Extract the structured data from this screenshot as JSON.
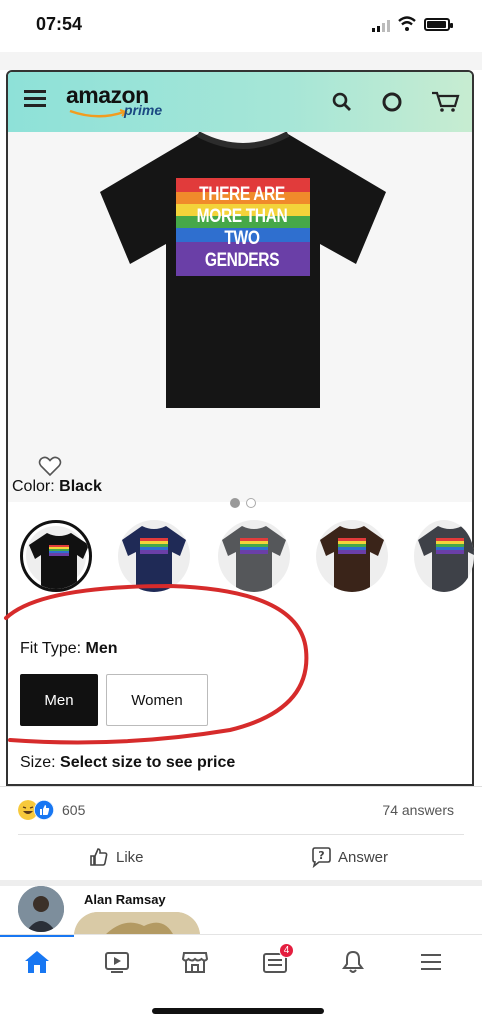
{
  "status_bar": {
    "time": "07:54"
  },
  "amazon": {
    "logo": "amazon",
    "prime": "prime",
    "shirt_text": [
      "THERE ARE",
      "MORE THAN",
      "TWO GENDERS"
    ],
    "color_label": "Color:",
    "color_value": "Black",
    "swatches": [
      {
        "color": "#111111",
        "selected": true
      },
      {
        "color": "#1f2a56",
        "selected": false
      },
      {
        "color": "#55575a",
        "selected": false
      },
      {
        "color": "#3a2419",
        "selected": false
      },
      {
        "color": "#3e4148",
        "selected": false
      }
    ],
    "fit_label": "Fit Type:",
    "fit_value": "Men",
    "fit_options": [
      "Men",
      "Women"
    ],
    "size_label": "Size:",
    "size_value": "Select size to see price",
    "accent_color": "#8ee1d8"
  },
  "facebook": {
    "reaction_count": "605",
    "answers_count": "74 answers",
    "like_label": "Like",
    "answer_label": "Answer",
    "commenter_name": "Alan Ramsay",
    "notification_badge": "4",
    "brand_color": "#1877f2"
  }
}
